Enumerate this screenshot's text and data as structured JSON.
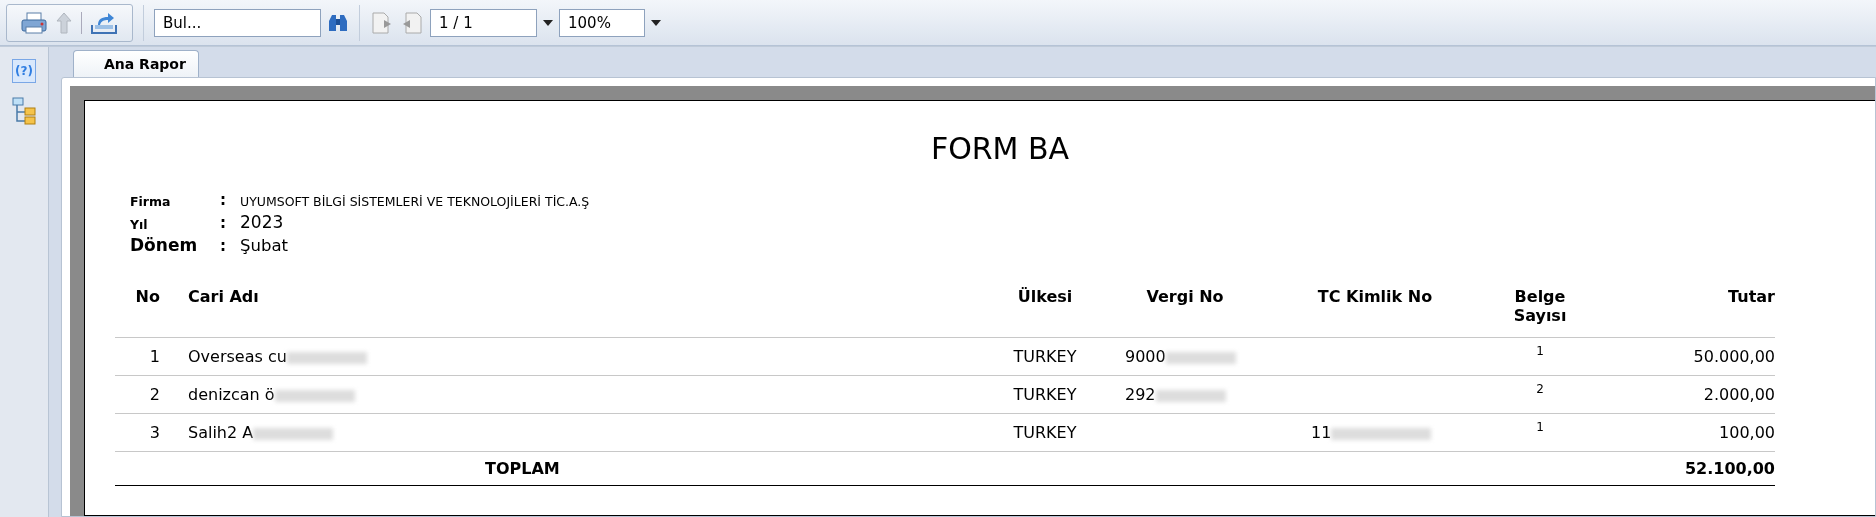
{
  "toolbar": {
    "search": {
      "placeholder": "Bul..."
    },
    "page": "1 / 1",
    "zoom": "100%"
  },
  "sidebar": {
    "help_label": "(?)"
  },
  "tabs": [
    {
      "label": "Ana Rapor",
      "selected": true
    }
  ],
  "report": {
    "title": "FORM BA",
    "info": [
      {
        "label": "Firma",
        "colon": ":",
        "value": "UYUMSOFT BİLGİ SİSTEMLERİ VE TEKNOLOJİLERİ TİC.A.Ş",
        "kind": "small"
      },
      {
        "label": "Yıl",
        "colon": ":",
        "value": "2023",
        "kind": "medium"
      },
      {
        "label": "Dönem",
        "colon": ":",
        "value": "Şubat",
        "kind": "large"
      }
    ],
    "columns": [
      "No",
      "Cari Adı",
      "Ülkesi",
      "Vergi No",
      "TC Kimlik No",
      "Belge Sayısı",
      "Tutar"
    ],
    "rows": [
      {
        "no": "1",
        "name": "Overseas cu",
        "country": "TURKEY",
        "tax_no": "9000",
        "tc_no": "",
        "documents": "1",
        "amount": "50.000,00"
      },
      {
        "no": "2",
        "name": "denizcan ö",
        "country": "TURKEY",
        "tax_no": "292",
        "tc_no": "",
        "documents": "2",
        "amount": "2.000,00"
      },
      {
        "no": "3",
        "name": "Salih2 A",
        "country": "TURKEY",
        "tax_no": "",
        "tc_no": "11",
        "documents": "1",
        "amount": "100,00"
      }
    ],
    "total": {
      "label": "TOPLAM",
      "amount": "52.100,00"
    }
  }
}
